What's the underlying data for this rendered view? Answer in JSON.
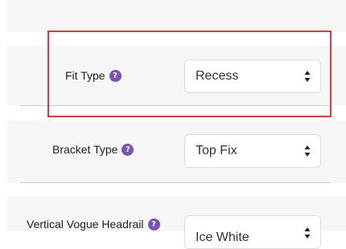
{
  "accent_color": "#e53935",
  "help_icon_color": "#7b52b8",
  "options": [
    {
      "label": "Fit Type",
      "help_glyph": "?",
      "selected": "Recess"
    },
    {
      "label": "Bracket Type",
      "help_glyph": "?",
      "selected": "Top Fix"
    },
    {
      "label": "Vertical Vogue Headrail",
      "help_glyph": "?",
      "selected": "Ice White"
    }
  ]
}
